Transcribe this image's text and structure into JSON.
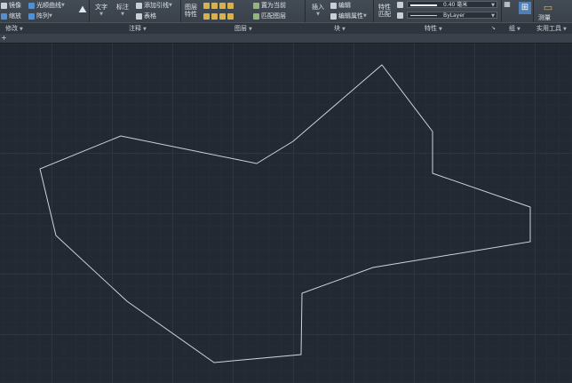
{
  "ribbon": {
    "modify": {
      "mirror": "镜像",
      "fillet": "光顺曲线",
      "scale": "缩放",
      "array": "阵列",
      "panel_title": "修改"
    },
    "annotation": {
      "text": "文字",
      "dimension": "标注",
      "leader": "添加引线",
      "table": "表格",
      "panel_title": "注释"
    },
    "layers": {
      "layer_props_line1": "图层",
      "layer_props_line2": "特性",
      "set_current": "置为当前",
      "match_layer": "匹配图层",
      "panel_title": "图层"
    },
    "block": {
      "insert": "插入",
      "edit": "编辑",
      "edit_attributes": "编辑属性",
      "panel_title": "块"
    },
    "properties": {
      "properties_line1": "特性",
      "properties_line2": "匹配",
      "lineweight_value": "0.40 毫米",
      "linetype_value": "ByLayer",
      "panel_title": "特性"
    },
    "groups": {
      "panel_title": "组"
    },
    "utilities": {
      "measure": "测量",
      "panel_title": "实用工具"
    }
  },
  "drawing": {
    "line_color": "#cdd3da",
    "background": "#222933",
    "grid_major_color": "#2d3541"
  }
}
